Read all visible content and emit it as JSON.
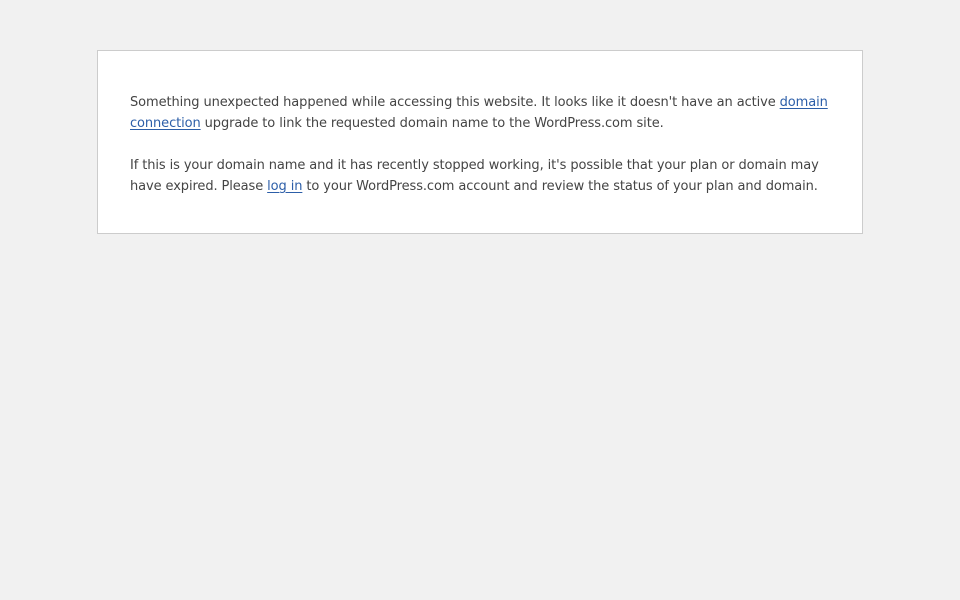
{
  "page": {
    "background_color": "#f1f1f1",
    "box_color": "#ffffff",
    "border_color": "#cccccc",
    "text_color": "#444444",
    "link_color": "#2c5ea8"
  },
  "message": {
    "paragraph_1": {
      "before_link": "Something unexpected happened while accessing this website. It looks like it doesn't have an active ",
      "link_text": "domain connection",
      "after_link": " upgrade to link the requested domain name to the WordPress.com site."
    },
    "paragraph_2": {
      "before_link": "If this is your domain name and it has recently stopped working, it's possible that your plan or domain may have expired. Please ",
      "link_text": "log in",
      "after_link": " to your WordPress.com account and review the status of your plan and domain."
    }
  }
}
